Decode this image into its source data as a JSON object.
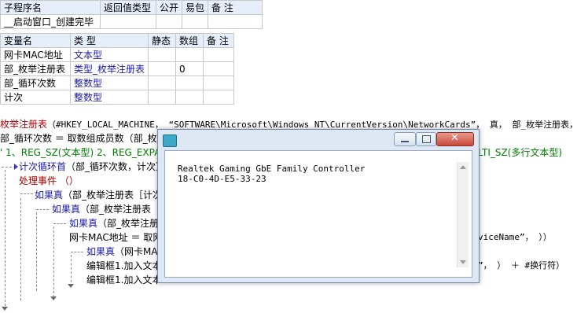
{
  "sub_table": {
    "headers": [
      "子程序名",
      "返回值类型",
      "公开",
      "易包",
      "备 注"
    ],
    "row": [
      "__启动窗口_创建完毕",
      "",
      "",
      "",
      ""
    ]
  },
  "var_table": {
    "headers": [
      "变量名",
      "类 型",
      "静态",
      "数组",
      "备 注"
    ],
    "rows": [
      [
        "网卡MAC地址",
        "文本型",
        "",
        "",
        ""
      ],
      [
        "部_枚举注册表",
        "类型_枚举注册表",
        "",
        "0",
        ""
      ],
      [
        "部_循环次数",
        "整数型",
        "",
        "",
        ""
      ],
      [
        "计次",
        "整数型",
        "",
        "",
        ""
      ]
    ]
  },
  "code": {
    "line1_fn": "枚举注册表",
    "line1_args": "（#HKEY_LOCAL_MACHINE， “SOFTWARE\\Microsoft\\Windows NT\\CurrentVersion\\NetworkCards”， 真， 部_枚举注册表， ）",
    "line2": "部_循环次数 ＝ 取数组成员数（部_枚",
    "line3_left": "' 1、REG_SZ(文本型) 2、REG_EXPAND",
    "line3_right": "LTI_SZ(多行文本型)",
    "line4_kw": "计次循环首",
    "line4_rest": "（部_循环次数，计次）",
    "line5": "处理事件 （）",
    "line6_kw": "如果真",
    "line6_rest": "（部_枚举注册表［计次",
    "line7_kw": "如果真",
    "line7_rest": "（部_枚举注册表",
    "line8_kw": "如果真",
    "line8_rest": "（部_枚举注册",
    "line9_left": "网卡MAC地址 ＝ 取网",
    "line9_right": "viceName”， ））",
    "line10_kw": "如果真",
    "line10_rest": "（网卡MAC",
    "line11_left": "编辑框1.加入文本",
    "line11_right": "”， ） ＋ #换行符）",
    "line12_left": "编辑框1.加入文本"
  },
  "popup": {
    "icon": "app-icon",
    "text": "Realtek Gaming GbE Family Controller\n18-C0-4D-E5-33-23",
    "buttons": [
      "minimize-icon",
      "maximize-icon",
      "close-icon"
    ],
    "close_color": "#c84a3c"
  }
}
